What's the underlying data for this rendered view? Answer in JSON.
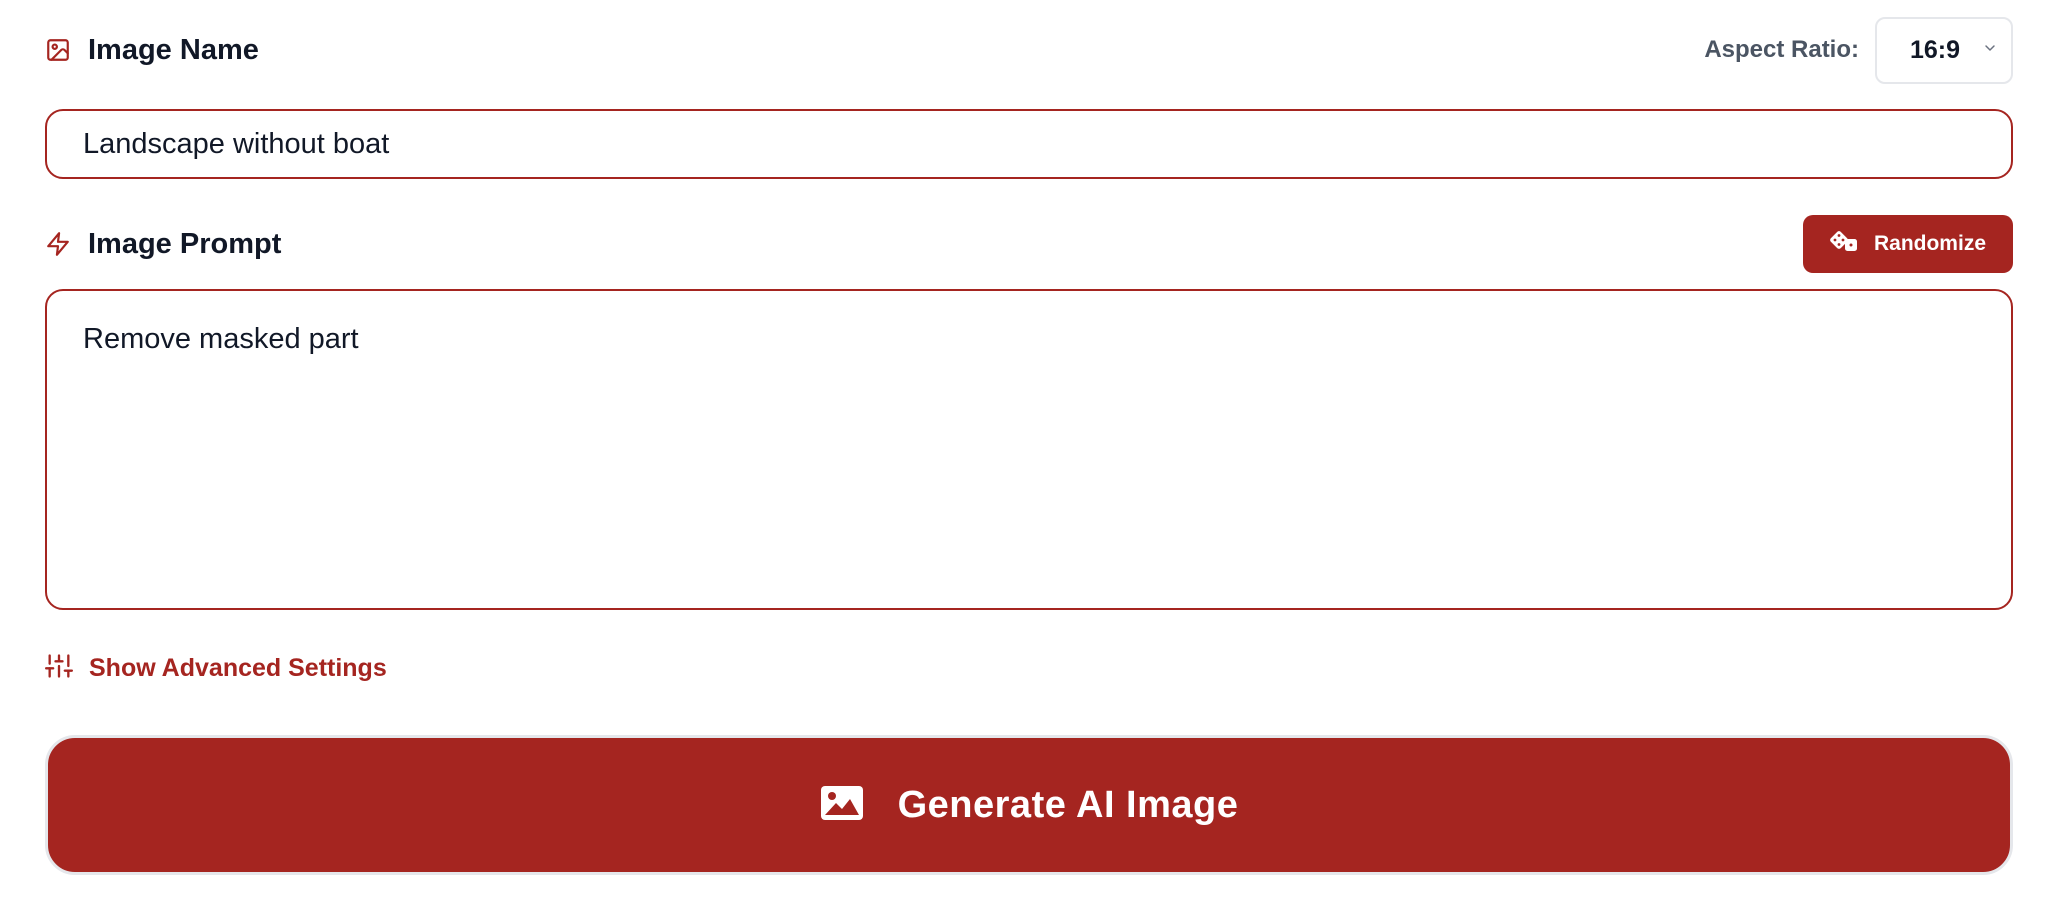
{
  "image_name": {
    "label": "Image Name",
    "value": "Landscape without boat",
    "icon": "image-icon"
  },
  "aspect_ratio": {
    "label": "Aspect Ratio:",
    "value": "16:9",
    "icon": "chevron-down-icon"
  },
  "image_prompt": {
    "label": "Image Prompt",
    "value": "Remove masked part",
    "icon": "lightning-icon"
  },
  "randomize": {
    "label": "Randomize",
    "icon": "dice-icon"
  },
  "advanced_settings": {
    "label": "Show Advanced Settings",
    "icon": "sliders-icon"
  },
  "generate": {
    "label": "Generate AI Image",
    "icon": "image-icon"
  },
  "colors": {
    "accent": "#a52520",
    "text": "#111827",
    "muted": "#4b5563",
    "border_light": "#e5e7eb"
  }
}
